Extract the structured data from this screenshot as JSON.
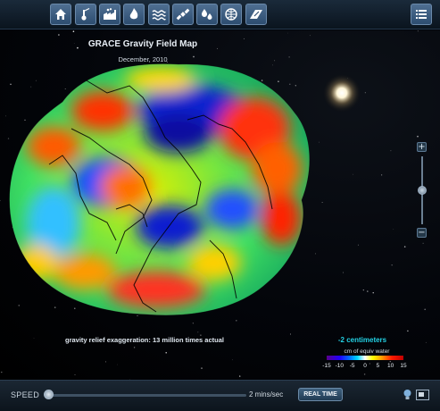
{
  "toolbar": {
    "buttons": [
      {
        "icon": "home-icon"
      },
      {
        "icon": "thermometer-icon"
      },
      {
        "icon": "factory-co2-icon"
      },
      {
        "icon": "flame-ozone-icon"
      },
      {
        "icon": "sea-level-waves-icon"
      },
      {
        "icon": "satellite-icon"
      },
      {
        "icon": "water-drops-icon"
      },
      {
        "icon": "gravity-globe-icon"
      },
      {
        "icon": "ice-sheet-icon"
      }
    ],
    "menu_icon": "list-icon"
  },
  "map": {
    "title": "GRACE Gravity Field Map",
    "date": "December, 2010",
    "exaggeration": "gravity relief exaggeration: 13 million times actual"
  },
  "zoom": {
    "plus": "+",
    "minus": "−",
    "level": 0.45
  },
  "legend": {
    "value": "-2 centimeters",
    "unit": "cm of equiv water",
    "ticks": [
      "-15",
      "-10",
      "-5",
      "0",
      "5",
      "10",
      "15"
    ]
  },
  "bottom": {
    "speed_label": "SPEED",
    "speed_value": "2 mins/sec",
    "speed_level": 0.0,
    "realtime_label": "REAL TIME"
  },
  "colors": {
    "toolbar_button": "#3d5f82",
    "legend_value": "#23d1e4",
    "accent": "#6b8aa7"
  }
}
